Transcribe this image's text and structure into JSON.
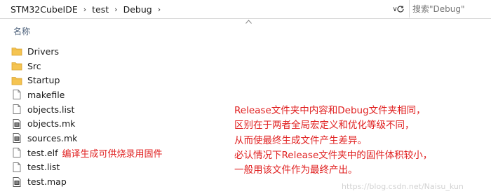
{
  "address_bar": {
    "breadcrumbs": [
      "STM32CubeIDE",
      "test",
      "Debug"
    ]
  },
  "search": {
    "placeholder": "搜索\"Debug\""
  },
  "columns": {
    "name_header": "名称"
  },
  "files": [
    {
      "name": "Drivers",
      "icon": "folder-icon"
    },
    {
      "name": "Src",
      "icon": "folder-icon"
    },
    {
      "name": "Startup",
      "icon": "folder-icon"
    },
    {
      "name": "makefile",
      "icon": "file-icon"
    },
    {
      "name": "objects.list",
      "icon": "file-icon"
    },
    {
      "name": "objects.mk",
      "icon": "mk-file-icon"
    },
    {
      "name": "sources.mk",
      "icon": "mk-file-icon"
    },
    {
      "name": "test.elf",
      "icon": "file-icon"
    },
    {
      "name": "test.list",
      "icon": "file-icon"
    },
    {
      "name": "test.map",
      "icon": "mk-file-icon"
    }
  ],
  "annotations": {
    "elf_note": "编译生成可供烧录用固件",
    "lines": [
      "Release文件夹中内容和Debug文件夹相同，",
      "区别在于两者全局宏定义和优化等级不同，",
      "从而使最终生成文件产生差异。",
      "必认情况下Release文件夹中的固件体积较小，",
      "一般用该文件作为最终产出。"
    ],
    "color": "#e02020"
  },
  "watermark": "https://blog.csdn.net/Naisu_kun"
}
